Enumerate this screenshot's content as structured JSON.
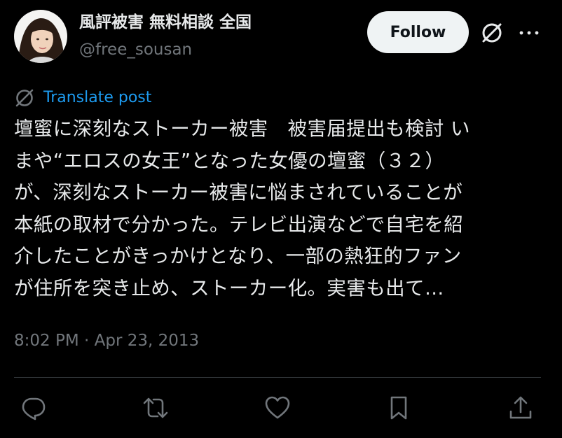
{
  "author": {
    "display_name": "風評被害 無料相談 全国",
    "handle": "@free_sousan"
  },
  "actions_top": {
    "follow_label": "Follow"
  },
  "translate": {
    "label": "Translate post"
  },
  "post": {
    "lines": [
      "壇蜜に深刻なストーカー被害　被害届提出も検討 い",
      "まや“エロスの女王”となった女優の壇蜜（３２）",
      "が、深刻なストーカー被害に悩まされていることが",
      "本紙の取材で分かった。テレビ出演などで自宅を紹",
      "介したことがきっかけとなり、一部の熱狂的ファン",
      "が住所を突き止め、ストーカー化。実害も出て…"
    ],
    "timestamp": "8:02 PM · Apr 23, 2013"
  },
  "icons": {
    "grok": "grok-icon",
    "more": "more-icon",
    "translate": "translate-icon",
    "reply": "reply-icon",
    "repost": "repost-icon",
    "like": "like-icon",
    "bookmark": "bookmark-icon",
    "share": "share-icon"
  },
  "colors": {
    "background": "#000000",
    "text_primary": "#e7e9ea",
    "text_secondary": "#71767b",
    "link": "#1d9bf0",
    "follow_bg": "#eff3f4",
    "divider": "#2f3336"
  }
}
